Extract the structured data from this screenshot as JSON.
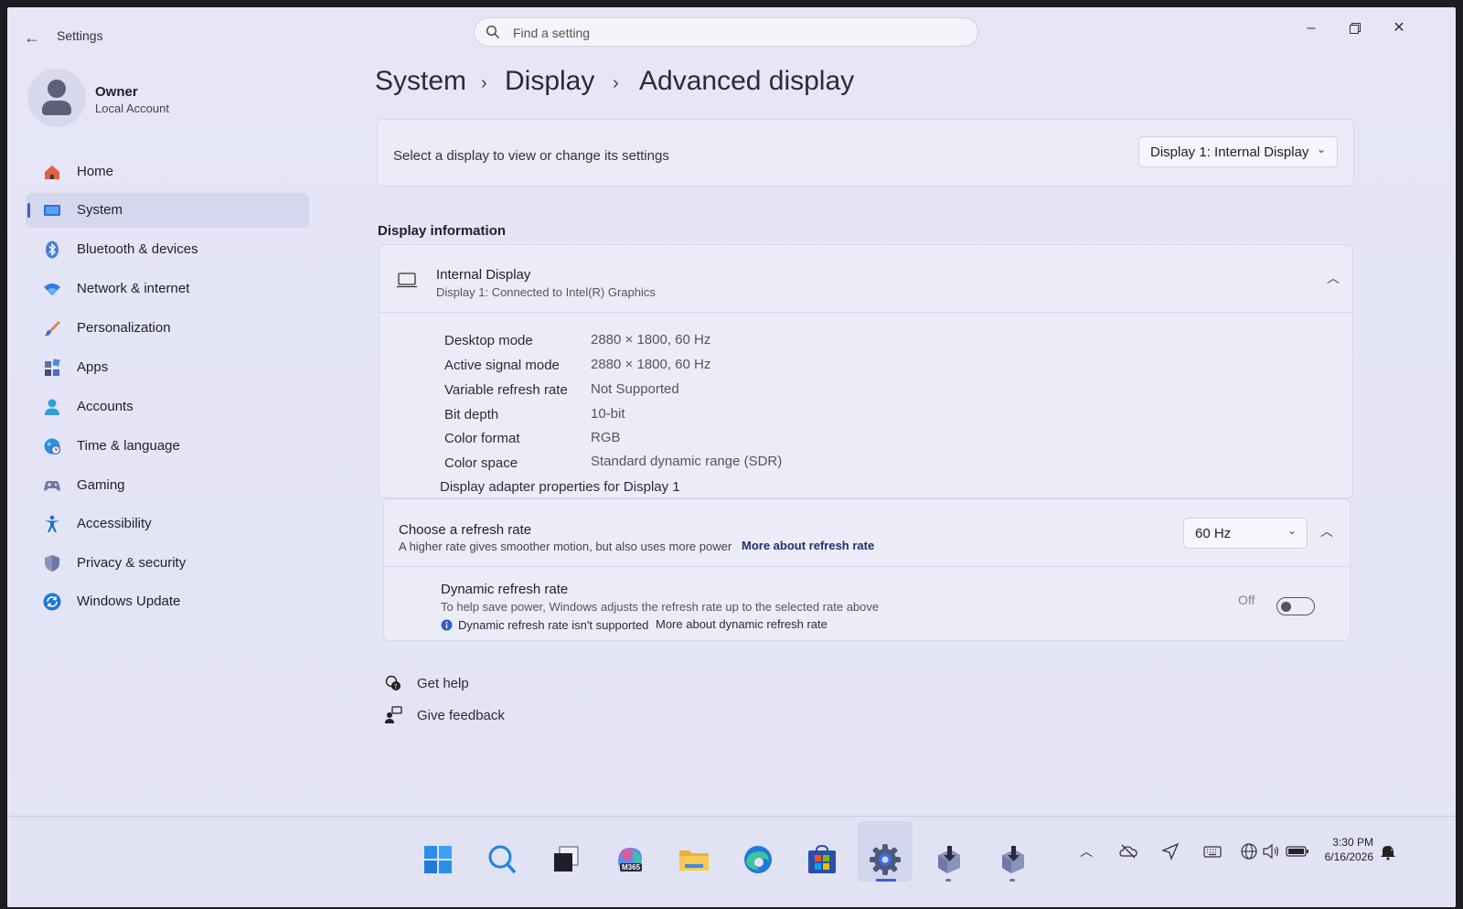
{
  "window": {
    "app_title": "Settings",
    "search_placeholder": "Find a setting"
  },
  "profile": {
    "name": "Owner",
    "account_type": "Local Account"
  },
  "sidebar": {
    "items": [
      {
        "label": "Home",
        "icon": "home-icon"
      },
      {
        "label": "System",
        "icon": "system-icon",
        "active": true
      },
      {
        "label": "Bluetooth & devices",
        "icon": "bluetooth-icon"
      },
      {
        "label": "Network & internet",
        "icon": "wifi-icon"
      },
      {
        "label": "Personalization",
        "icon": "brush-icon"
      },
      {
        "label": "Apps",
        "icon": "apps-icon"
      },
      {
        "label": "Accounts",
        "icon": "accounts-icon"
      },
      {
        "label": "Time & language",
        "icon": "globe-clock-icon"
      },
      {
        "label": "Gaming",
        "icon": "gamepad-icon"
      },
      {
        "label": "Accessibility",
        "icon": "accessibility-icon"
      },
      {
        "label": "Privacy & security",
        "icon": "shield-icon"
      },
      {
        "label": "Windows Update",
        "icon": "update-icon"
      }
    ]
  },
  "breadcrumb": {
    "items": [
      "System",
      "Display",
      "Advanced display"
    ],
    "separator": "›"
  },
  "display_select": {
    "label": "Select a display to view or change its settings",
    "value": "Display 1: Internal Display"
  },
  "display_info": {
    "heading": "Display information",
    "card_title": "Internal Display",
    "card_subtitle": "Display 1: Connected to Intel(R) Graphics",
    "rows": [
      {
        "label": "Desktop mode",
        "value": "2880 × 1800, 60 Hz"
      },
      {
        "label": "Active signal mode",
        "value": "2880 × 1800, 60 Hz"
      },
      {
        "label": "Variable refresh rate",
        "value": "Not Supported"
      },
      {
        "label": "Bit depth",
        "value": "10-bit"
      },
      {
        "label": "Color format",
        "value": "RGB"
      },
      {
        "label": "Color space",
        "value": "Standard dynamic range (SDR)"
      }
    ],
    "adapter_link": "Display adapter properties for Display 1"
  },
  "refresh": {
    "title": "Choose a refresh rate",
    "desc": "A higher rate gives smoother motion, but also uses more power",
    "more_link": "More about refresh rate",
    "value": "60 Hz",
    "dynamic_title": "Dynamic refresh rate",
    "dynamic_desc": "To help save power, Windows adjusts the refresh rate up to the selected rate above",
    "dynamic_note": "Dynamic refresh rate isn't supported",
    "dynamic_link": "More about dynamic refresh rate",
    "toggle_state": "Off"
  },
  "help": {
    "get_help": "Get help",
    "give_feedback": "Give feedback"
  },
  "taskbar": {
    "m365_badge": "M365",
    "time": "3:30 PM",
    "date": "6/16/2026"
  },
  "colors": {
    "accent": "#3a5fd0",
    "background": "#e6e6f7"
  }
}
